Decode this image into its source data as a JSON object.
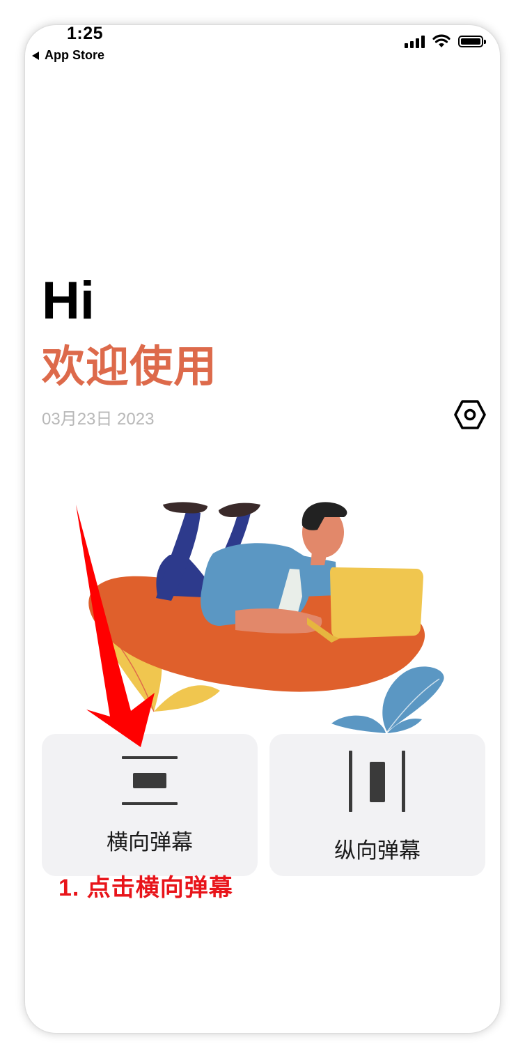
{
  "status_bar": {
    "time": "1:25",
    "back_label": "App Store",
    "signal_icon": "cellular-signal-icon",
    "wifi_icon": "wifi-icon",
    "battery_icon": "battery-icon"
  },
  "greeting": {
    "hi": "Hi",
    "welcome": "欢迎使用",
    "date": "03月23日 2023"
  },
  "settings_icon": "hexagon-settings-icon",
  "illustration": "person-lying-with-laptop-illustration",
  "modes": [
    {
      "label": "横向弹幕",
      "icon": "horizontal-danmaku-icon"
    },
    {
      "label": "纵向弹幕",
      "icon": "vertical-danmaku-icon"
    }
  ],
  "annotation": {
    "text": "1. 点击横向弹幕",
    "color": "#e8141a",
    "arrow_icon": "red-arrow-down-icon"
  },
  "colors": {
    "accent": "#dd6a4b",
    "card_bg": "#f2f2f4",
    "date": "#b8b8b8"
  }
}
